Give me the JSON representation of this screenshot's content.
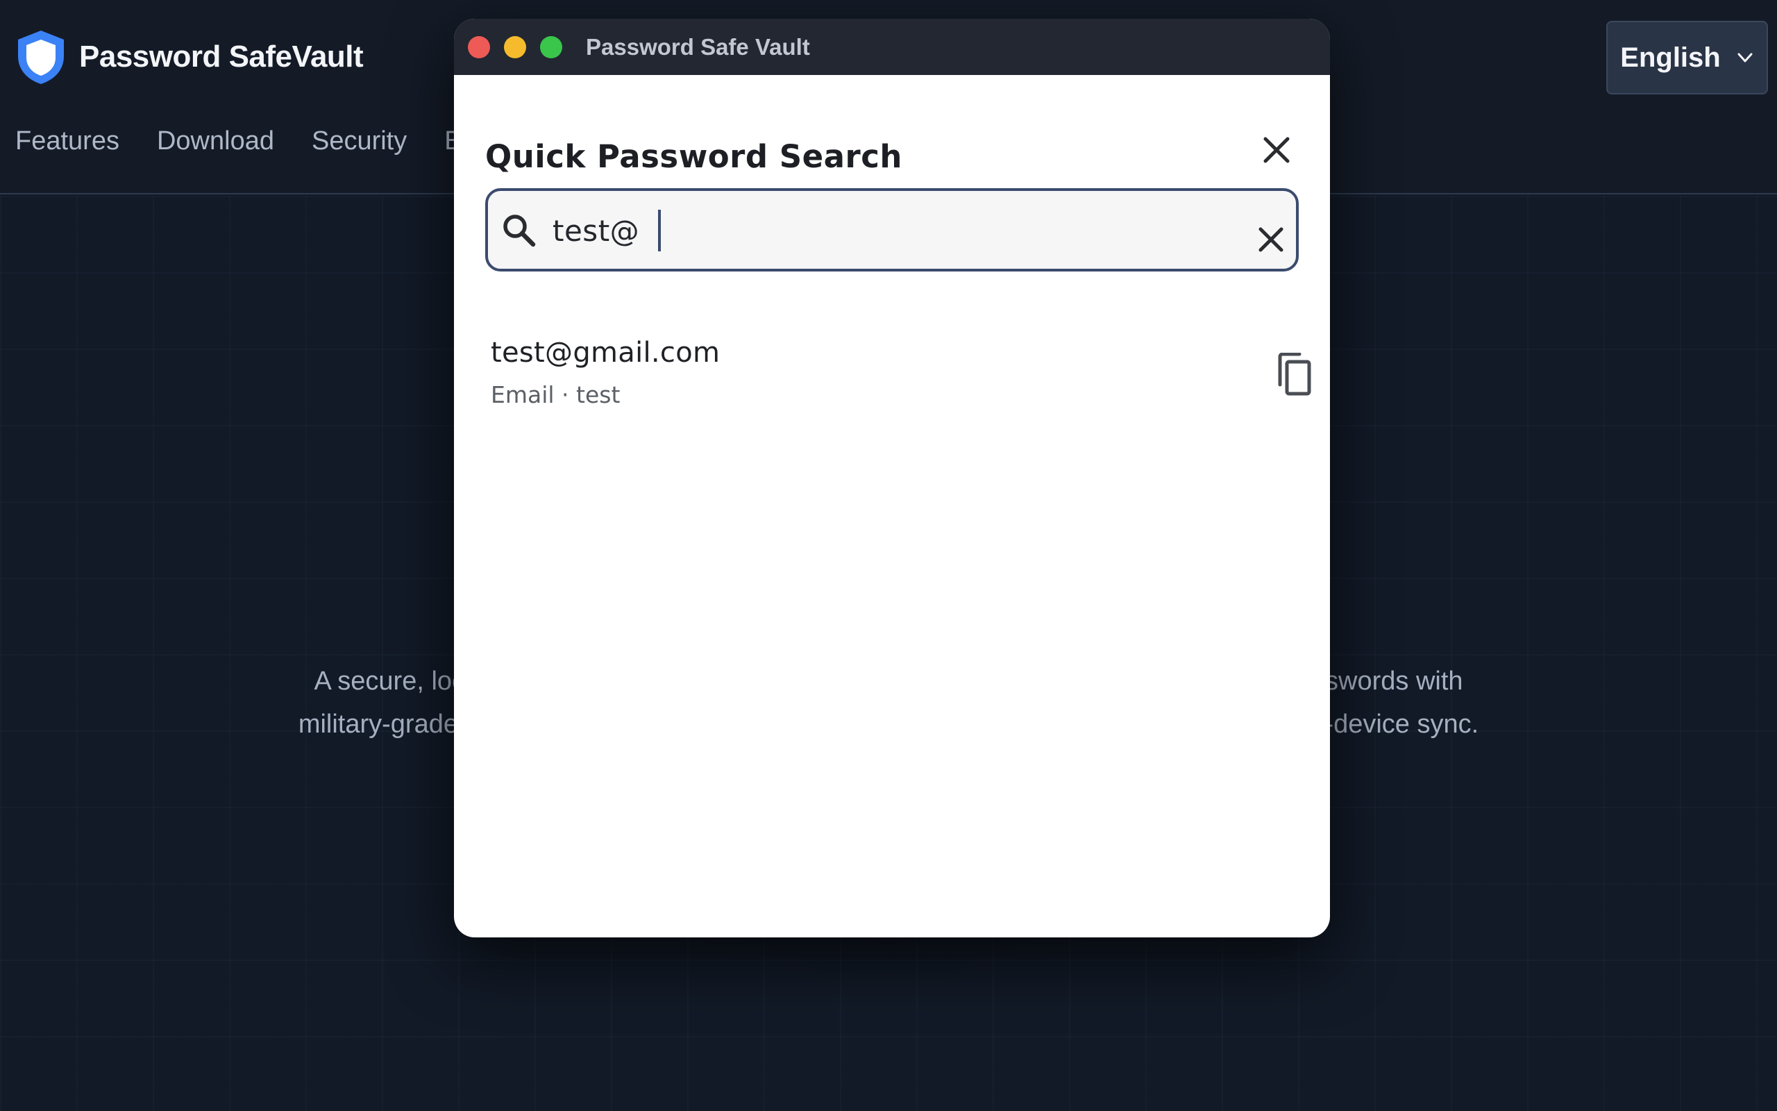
{
  "site": {
    "brand_name": "Password SafeVault",
    "nav": [
      "Features",
      "Download",
      "Security",
      "E"
    ],
    "language": "English",
    "tagline_line1": "A secure, loc",
    "tagline_line1_end": "sswords with",
    "tagline_line2": "military-grade",
    "tagline_line2_end": "i-device sync."
  },
  "window": {
    "title": "Password Safe Vault"
  },
  "panel": {
    "title": "Quick Password Search"
  },
  "search": {
    "value": "test@"
  },
  "results": [
    {
      "primary": "test@gmail.com",
      "secondary": "Email · test"
    }
  ],
  "icons": {
    "logo": "shield-icon",
    "language_caret": "chevron-down-icon",
    "panel_close": "close-icon",
    "search": "search-icon",
    "clear": "close-icon",
    "copy": "copy-icon"
  },
  "colors": {
    "accent": "#3b4b6e",
    "shield": "#3b82f6",
    "traffic_close": "#ee5a55",
    "traffic_min": "#f5bb2d",
    "traffic_max": "#39c64a"
  }
}
